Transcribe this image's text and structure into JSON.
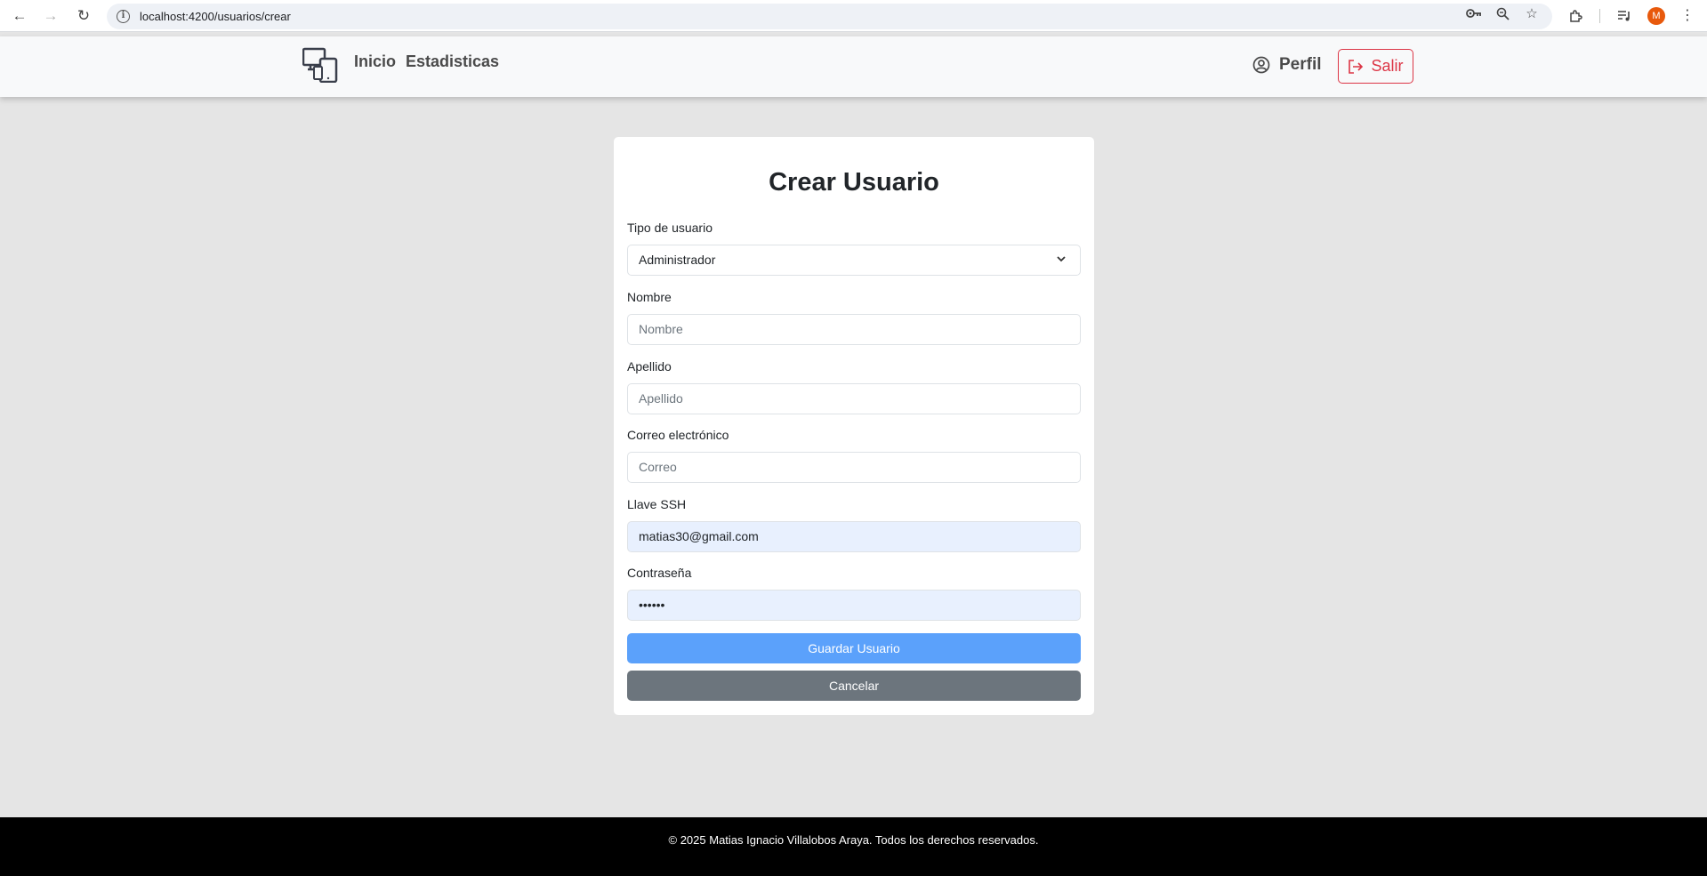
{
  "browser": {
    "url": "localhost:4200/usuarios/crear",
    "avatar_letter": "M"
  },
  "navbar": {
    "links": [
      "Inicio",
      "Estadisticas"
    ],
    "profile_label": "Perfil",
    "logout_label": "Salir",
    "logout_color": "#dc3545"
  },
  "form": {
    "title": "Crear Usuario",
    "user_type": {
      "label": "Tipo de usuario",
      "selected": "Administrador"
    },
    "first_name": {
      "label": "Nombre",
      "placeholder": "Nombre",
      "value": ""
    },
    "last_name": {
      "label": "Apellido",
      "placeholder": "Apellido",
      "value": ""
    },
    "email": {
      "label": "Correo electrónico",
      "placeholder": "Correo",
      "value": ""
    },
    "ssh_key": {
      "label": "Llave SSH",
      "value": "matias30@gmail.com"
    },
    "password": {
      "label": "Contraseña",
      "value": "••••••"
    },
    "save_label": "Guardar Usuario",
    "cancel_label": "Cancelar",
    "primary_color": "#5ba1fb",
    "secondary_color": "#6c757d"
  },
  "footer": {
    "text": "© 2025 Matias Ignacio Villalobos Araya. Todos los derechos reservados."
  }
}
